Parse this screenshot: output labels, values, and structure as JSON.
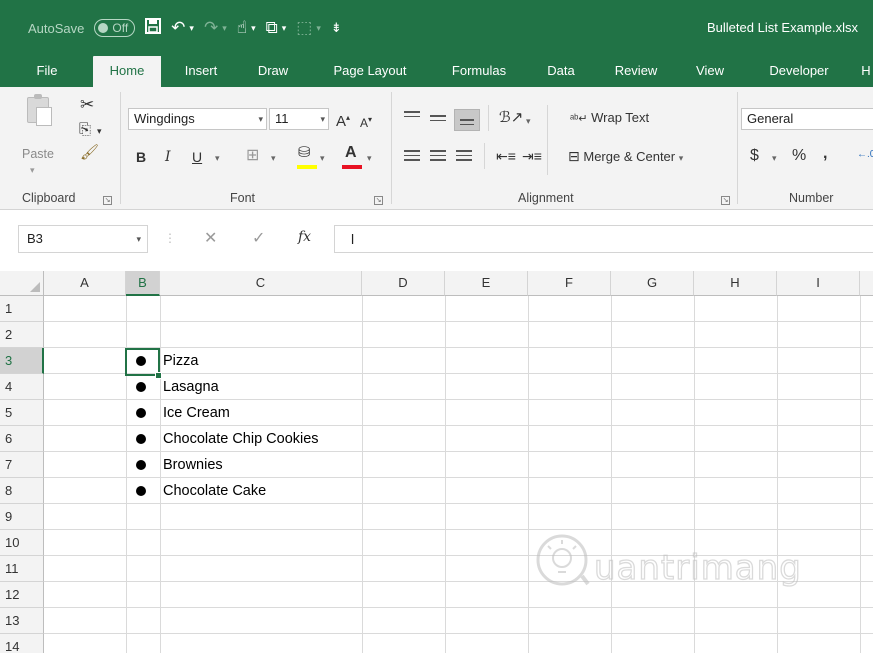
{
  "qat": {
    "autosave_label": "AutoSave",
    "autosave_state": "Off",
    "document_title": "Bulleted List Example.xlsx"
  },
  "tabs": [
    "File",
    "Home",
    "Insert",
    "Draw",
    "Page Layout",
    "Formulas",
    "Data",
    "Review",
    "View",
    "Developer",
    "H"
  ],
  "active_tab": "Home",
  "ribbon": {
    "clipboard": {
      "paste_label": "Paste",
      "group_label": "Clipboard"
    },
    "font": {
      "font_name": "Wingdings",
      "font_size": "11",
      "bold": "B",
      "italic": "I",
      "underline": "U",
      "grow": "A",
      "shrink": "A",
      "font_color_letter": "A",
      "group_label": "Font"
    },
    "alignment": {
      "wrap_text": "Wrap Text",
      "merge_center": "Merge & Center",
      "group_label": "Alignment"
    },
    "number": {
      "format": "General",
      "currency": "$",
      "percent": "%",
      "comma": ",",
      "group_label": "Number"
    }
  },
  "formula_bar": {
    "name_box": "B3",
    "fx_label": "fx",
    "content": "l"
  },
  "columns": [
    "A",
    "B",
    "C",
    "D",
    "E",
    "F",
    "G",
    "H",
    "I"
  ],
  "selected_column": "B",
  "rows": [
    "1",
    "2",
    "3",
    "4",
    "5",
    "6",
    "7",
    "8",
    "9",
    "10",
    "11",
    "12",
    "13",
    "14"
  ],
  "selected_row": "3",
  "list_items": [
    "Pizza",
    "Lasagna",
    "Ice Cream",
    "Chocolate Chip Cookies",
    "Brownies",
    "Chocolate Cake"
  ],
  "watermark": "uantrimang",
  "colors": {
    "excel_green": "#217346",
    "ribbon_bg": "#f3f3f3",
    "grid_line": "#dadada",
    "font_color_bar": "#e81123",
    "highlight_bar": "#ffff00"
  }
}
